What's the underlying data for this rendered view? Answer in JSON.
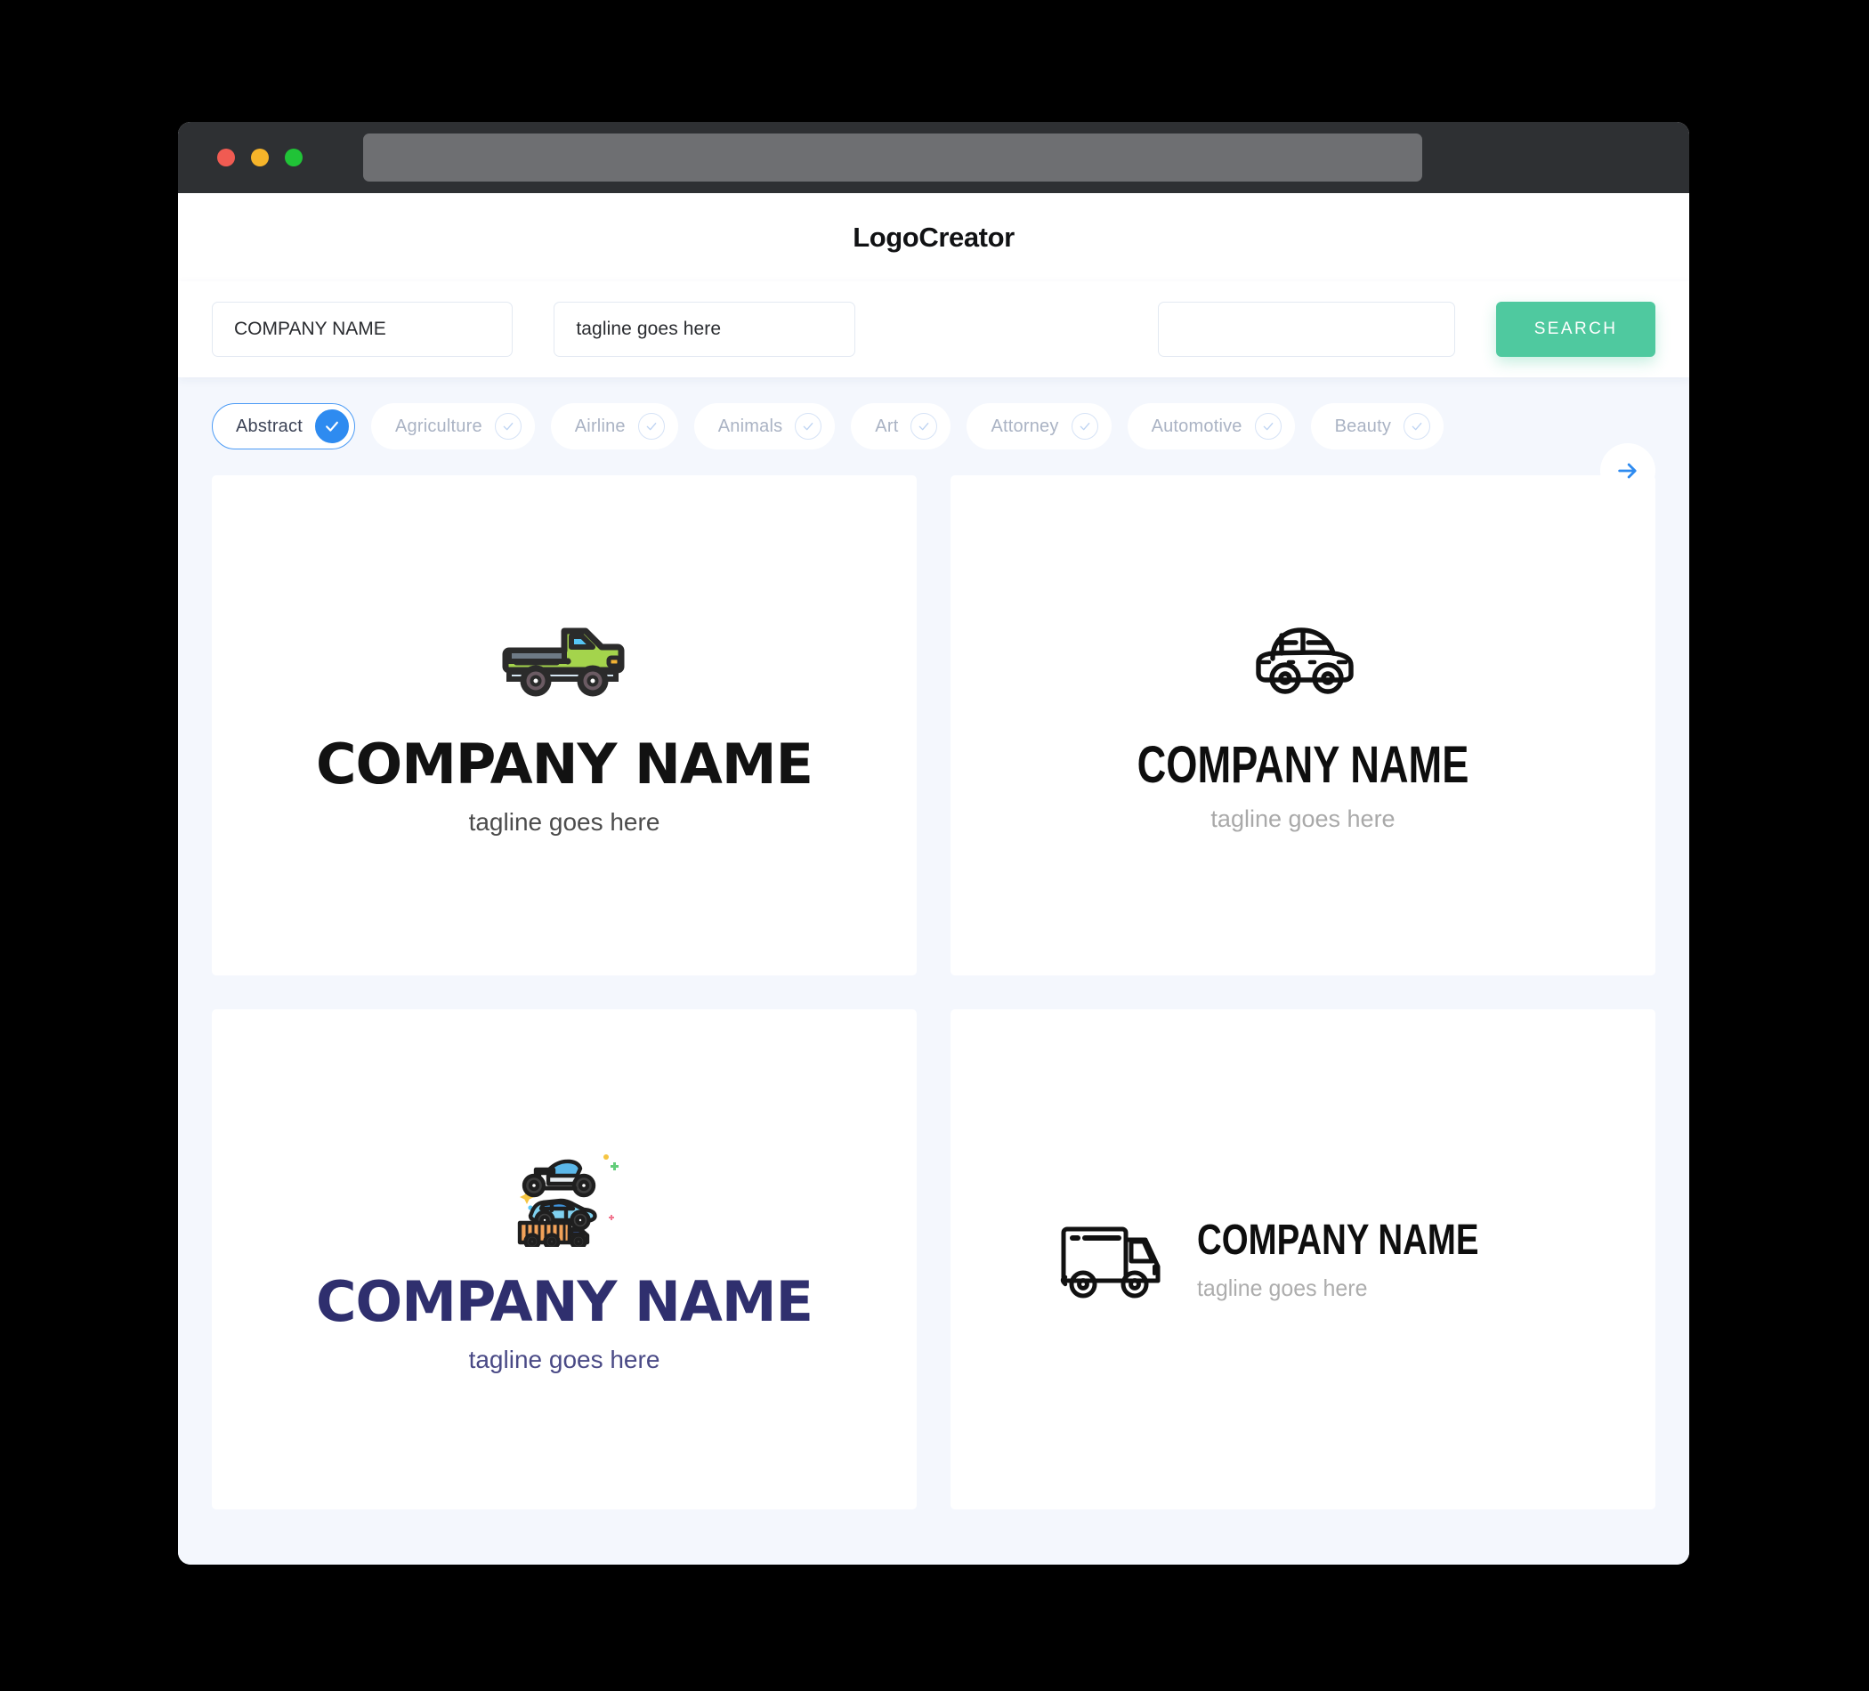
{
  "window": {
    "traffic_lights": [
      "close",
      "minimize",
      "maximize"
    ],
    "url_value": ""
  },
  "header": {
    "app_title": "LogoCreator"
  },
  "search": {
    "company_value": "COMPANY NAME",
    "company_placeholder": "COMPANY NAME",
    "tagline_value": "tagline goes here",
    "tagline_placeholder": "tagline goes here",
    "keyword_value": "",
    "keyword_placeholder": "",
    "search_label": "SEARCH"
  },
  "categories": {
    "next_icon": "arrow-right-icon",
    "items": [
      {
        "label": "Abstract",
        "selected": true
      },
      {
        "label": "Agriculture",
        "selected": false
      },
      {
        "label": "Airline",
        "selected": false
      },
      {
        "label": "Animals",
        "selected": false
      },
      {
        "label": "Art",
        "selected": false
      },
      {
        "label": "Attorney",
        "selected": false
      },
      {
        "label": "Automotive",
        "selected": false
      },
      {
        "label": "Beauty",
        "selected": false
      }
    ]
  },
  "results": {
    "cards": [
      {
        "id": "card-pickup-truck",
        "icon": "pickup-truck-icon",
        "layout": "stacked",
        "company": "COMPANY NAME",
        "tagline": "tagline goes here",
        "name_color": "#121212",
        "tagline_color": "#4c4c4c"
      },
      {
        "id": "card-outline-car",
        "icon": "car-outline-icon",
        "layout": "stacked",
        "company": "COMPANY NAME",
        "tagline": "tagline goes here",
        "name_color": "#0e0e0e",
        "tagline_color": "#a9a9a9"
      },
      {
        "id": "card-vehicle-trio",
        "icon": "motorcycle-car-truck-icon",
        "layout": "stacked",
        "company": "COMPANY NAME",
        "tagline": "tagline goes here",
        "name_color": "#2f2f6e",
        "tagline_color": "#4a4a86"
      },
      {
        "id": "card-delivery-truck",
        "icon": "delivery-truck-outline-icon",
        "layout": "horizontal",
        "company": "COMPANY NAME",
        "tagline": "tagline goes here",
        "name_color": "#0e0e0e",
        "tagline_color": "#adadad"
      }
    ]
  },
  "colors": {
    "page_bg": "#f4f7fd",
    "titlebar": "#2e3033",
    "accent_green": "#4fc99f",
    "accent_blue": "#2e8bf0",
    "chip_idle_text": "#aab3c4"
  }
}
